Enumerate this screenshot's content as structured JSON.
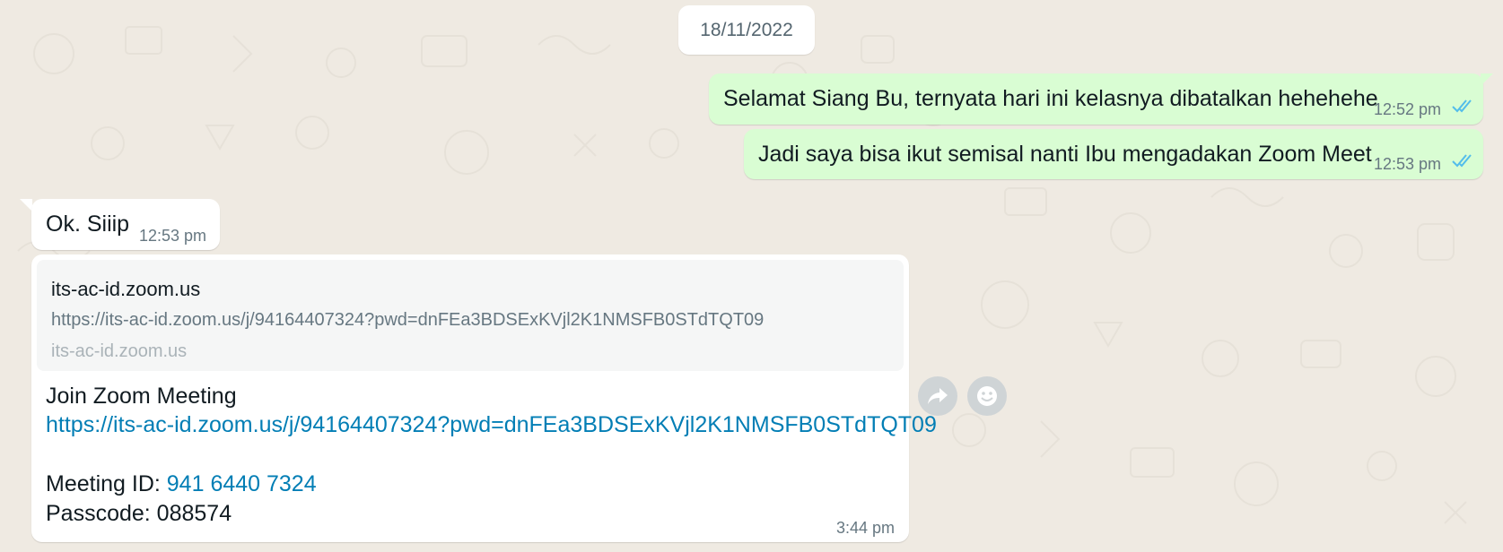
{
  "date_separator": "18/11/2022",
  "messages": [
    {
      "text": "Selamat Siang Bu, ternyata hari ini kelasnya dibatalkan hehehehe",
      "time": "12:52 pm"
    },
    {
      "text": "Jadi saya bisa ikut semisal nanti Ibu mengadakan Zoom Meet",
      "time": "12:53 pm"
    },
    {
      "text": "Ok. Siiip",
      "time": "12:53 pm"
    },
    {
      "preview": {
        "title": "its-ac-id.zoom.us",
        "url": "https://its-ac-id.zoom.us/j/94164407324?pwd=dnFEa3BDSExKVjl2K1NMSFB0STdTQT09",
        "domain": "its-ac-id.zoom.us"
      },
      "line1": "Join Zoom Meeting",
      "link": "https://its-ac-id.zoom.us/j/94164407324?pwd=dnFEa3BDSExKVjl2K1NMSFB0STdTQT09",
      "meeting_id_label": "Meeting ID: ",
      "meeting_id": "941 6440 7324",
      "passcode": "Passcode: 088574",
      "time": "3:44 pm"
    }
  ],
  "actions": {
    "forward_icon": "forward-icon",
    "emoji_icon": "emoji-icon"
  },
  "colors": {
    "outgoing": "#d9fdd3",
    "incoming": "#ffffff",
    "link": "#027eb5",
    "read_ticks": "#53bdeb",
    "background": "#efeae2"
  }
}
